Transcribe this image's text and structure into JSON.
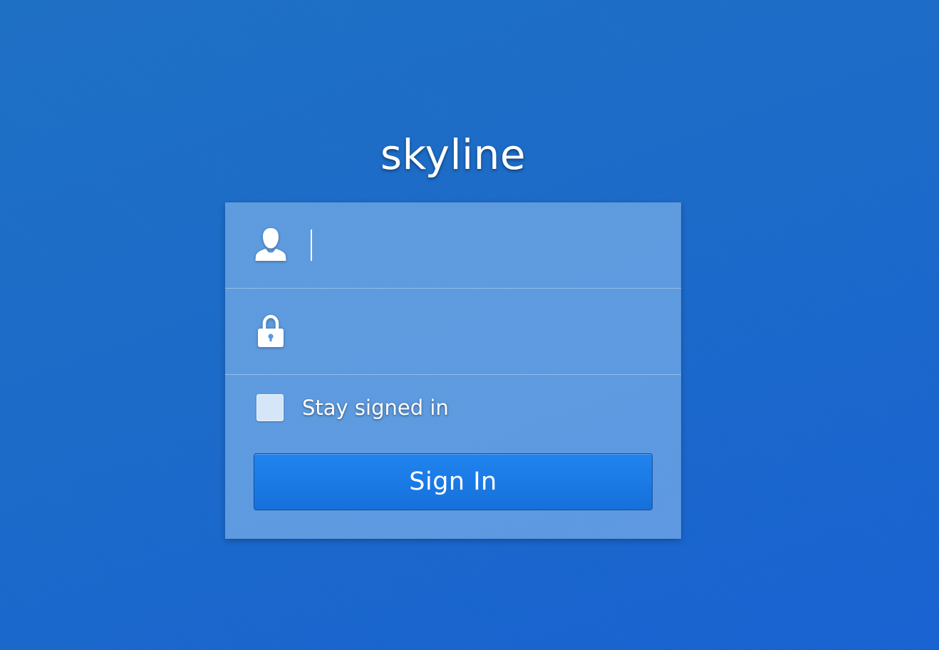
{
  "brand": {
    "name": "skyline"
  },
  "login": {
    "username": {
      "icon": "user-icon",
      "value": "",
      "placeholder": ""
    },
    "password": {
      "icon": "lock-icon",
      "value": "",
      "placeholder": ""
    },
    "remember": {
      "label": "Stay signed in",
      "checked": false
    },
    "submit_label": "Sign In"
  },
  "colors": {
    "background": "#1b6ac8",
    "panel": "#5b98de",
    "button": "#1a78e6",
    "text": "#ffffff"
  }
}
